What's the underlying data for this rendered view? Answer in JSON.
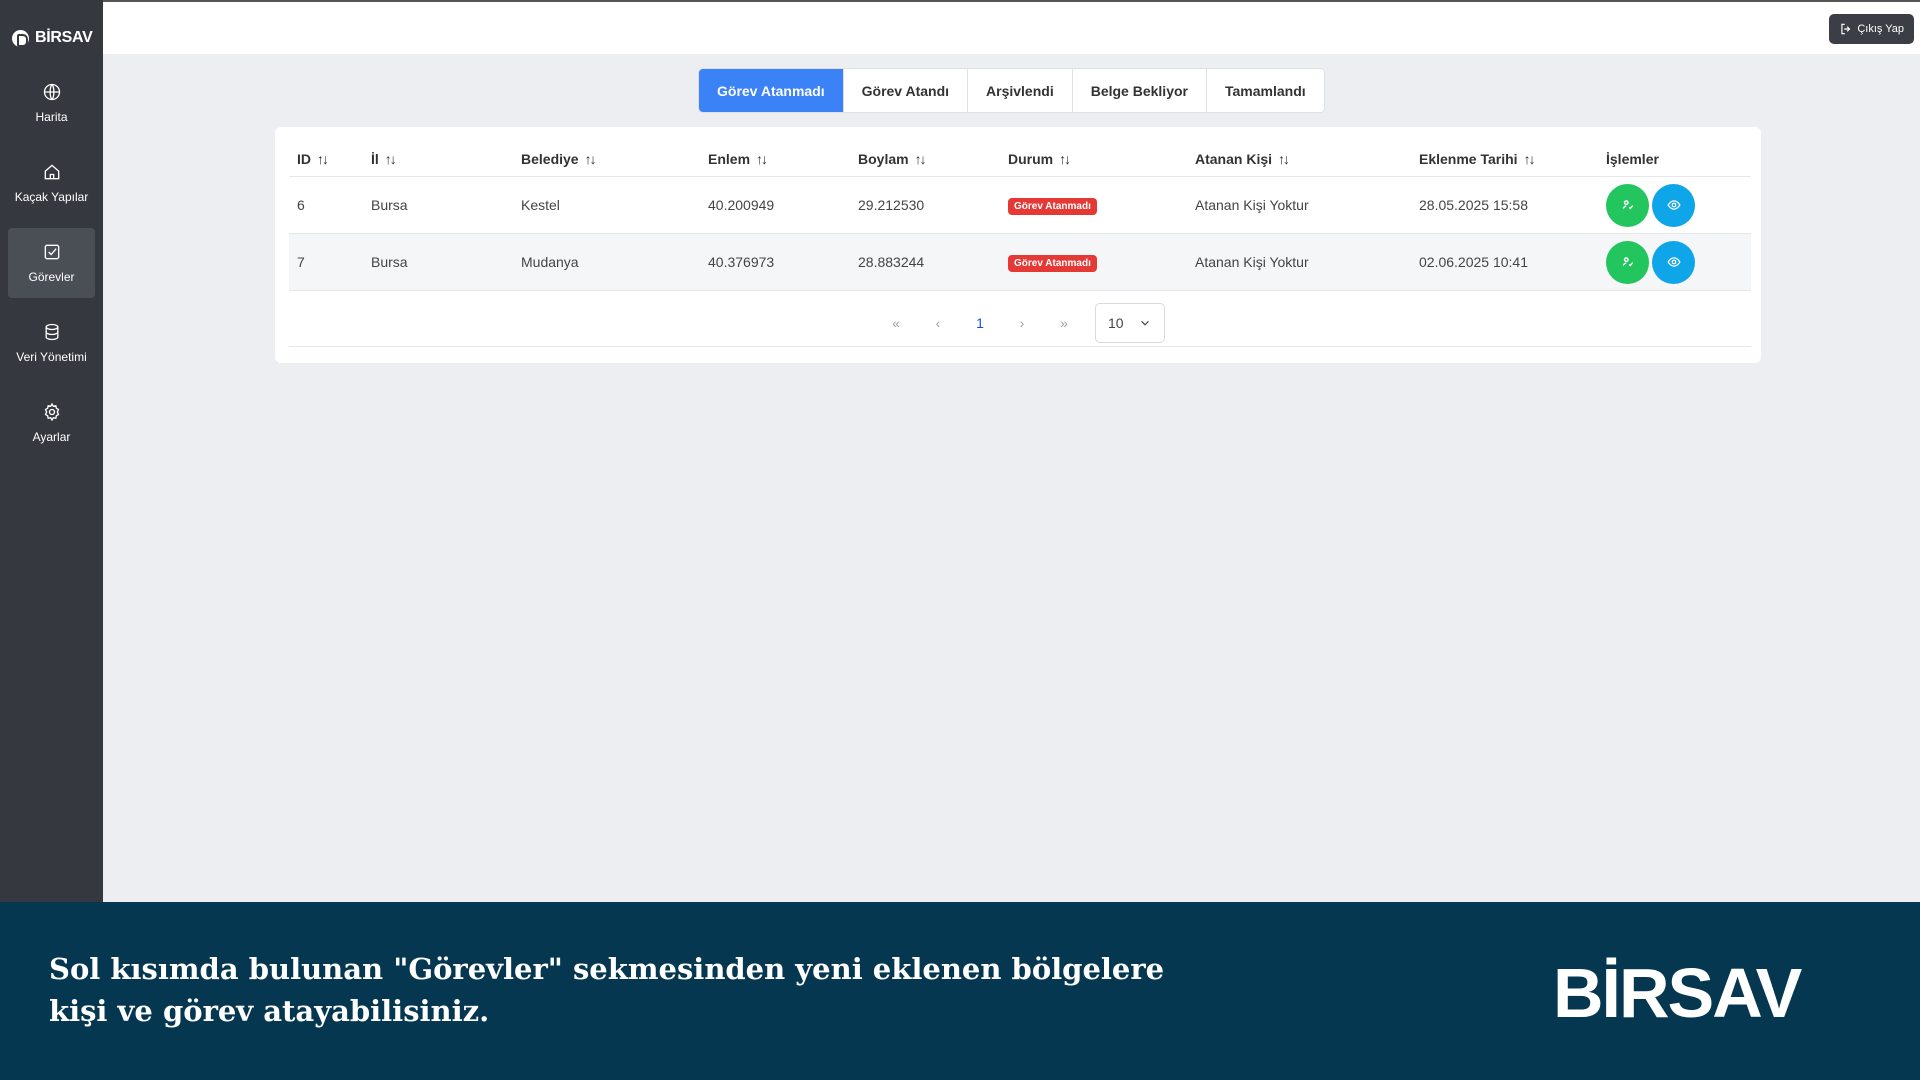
{
  "brand": {
    "name": "BİRSAV"
  },
  "sidebar": {
    "items": [
      {
        "label": "Harita",
        "icon": "globe-icon"
      },
      {
        "label": "Kaçak Yapılar",
        "icon": "home-icon"
      },
      {
        "label": "Görevler",
        "icon": "checkbox-icon",
        "active": true
      },
      {
        "label": "Veri Yönetimi",
        "icon": "database-icon"
      },
      {
        "label": "Ayarlar",
        "icon": "gear-icon"
      }
    ]
  },
  "header": {
    "logout_label": "Çıkış Yap"
  },
  "tabs": [
    {
      "label": "Görev Atanmadı",
      "active": true
    },
    {
      "label": "Görev Atandı"
    },
    {
      "label": "Arşivlendi"
    },
    {
      "label": "Belge Bekliyor"
    },
    {
      "label": "Tamamlandı"
    }
  ],
  "table": {
    "columns": [
      "ID",
      "İl",
      "Belediye",
      "Enlem",
      "Boylam",
      "Durum",
      "Atanan Kişi",
      "Eklenme Tarihi",
      "İşlemler"
    ],
    "sort_glyph": "↑↓",
    "rows": [
      {
        "id": "6",
        "il": "Bursa",
        "belediye": "Kestel",
        "enlem": "40.200949",
        "boylam": "29.212530",
        "durum": "Görev Atanmadı",
        "atanan": "Atanan Kişi Yoktur",
        "tarih": "28.05.2025 15:58"
      },
      {
        "id": "7",
        "il": "Bursa",
        "belediye": "Mudanya",
        "enlem": "40.376973",
        "boylam": "28.883244",
        "durum": "Görev Atanmadı",
        "atanan": "Atanan Kişi Yoktur",
        "tarih": "02.06.2025 10:41"
      }
    ]
  },
  "pagination": {
    "first": "«",
    "prev": "‹",
    "current": "1",
    "next": "›",
    "last": "»",
    "page_size": "10"
  },
  "banner": {
    "line1": "Sol kısımda bulunan \"Görevler\" sekmesinden yeni eklenen bölgelere",
    "line2": "kişi ve görev atayabilisiniz.",
    "logo": "BİRSAV"
  },
  "colors": {
    "sidebar": "#35393f",
    "accent": "#3b82f6",
    "badge": "#e53935",
    "assign": "#22c55e",
    "view": "#0ea5e9",
    "banner": "#063750"
  }
}
